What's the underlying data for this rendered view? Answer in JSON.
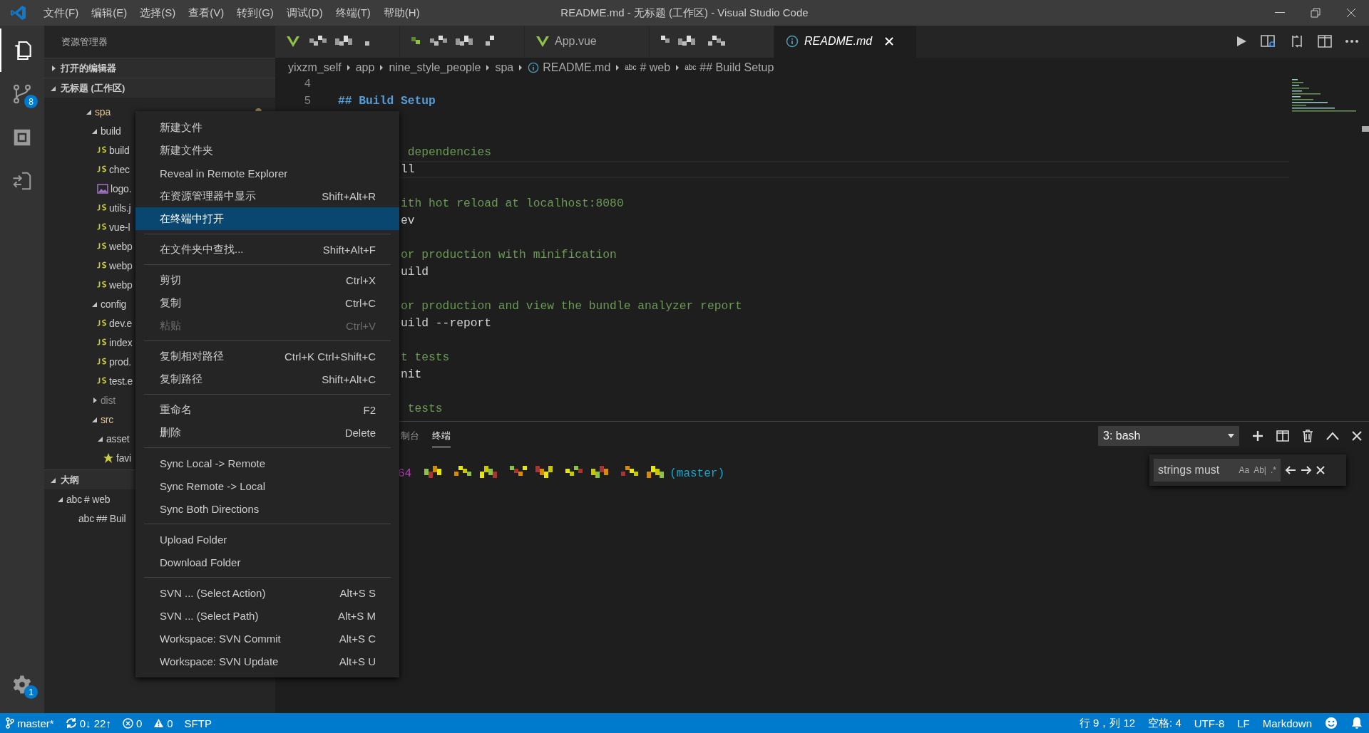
{
  "title_bar": {
    "menus": [
      "文件(F)",
      "编辑(E)",
      "选择(S)",
      "查看(V)",
      "转到(G)",
      "调试(D)",
      "终端(T)",
      "帮助(H)"
    ],
    "title": "README.md - 无标题 (工作区) - Visual Studio Code"
  },
  "activity_bar": {
    "items": [
      {
        "kind": "explorer",
        "selected": true
      },
      {
        "kind": "scm",
        "badge": "8",
        "selected": false
      },
      {
        "kind": "extensions",
        "selected": false
      },
      {
        "kind": "remote",
        "selected": false
      }
    ],
    "settings_badge": "1"
  },
  "sidebar": {
    "title": "资源管理器",
    "sections": [
      {
        "label": "打开的编辑器",
        "expanded": false
      },
      {
        "label": "无标题 (工作区)",
        "expanded": true
      }
    ],
    "tree": [
      {
        "label": "spa",
        "kind": "folder",
        "expanded": true,
        "modified": true,
        "children": [
          {
            "label": "build",
            "kind": "folder",
            "expanded": true,
            "children": [
              {
                "label": "build",
                "kind": "js"
              },
              {
                "label": "chec",
                "kind": "js"
              },
              {
                "label": "logo.",
                "kind": "image"
              },
              {
                "label": "utils.j",
                "kind": "js"
              },
              {
                "label": "vue-l",
                "kind": "js"
              },
              {
                "label": "webp",
                "kind": "js"
              },
              {
                "label": "webp",
                "kind": "js"
              },
              {
                "label": "webp",
                "kind": "js"
              }
            ]
          },
          {
            "label": "config",
            "kind": "folder",
            "expanded": true,
            "children": [
              {
                "label": "dev.e",
                "kind": "js"
              },
              {
                "label": "index",
                "kind": "js"
              },
              {
                "label": "prod.",
                "kind": "js"
              },
              {
                "label": "test.e",
                "kind": "js"
              }
            ]
          },
          {
            "label": "dist",
            "kind": "folder",
            "expanded": false,
            "ignored": true
          },
          {
            "label": "src",
            "kind": "folder",
            "expanded": true,
            "modified": true,
            "children": [
              {
                "label": "asset",
                "kind": "folder",
                "expanded": true,
                "children": [
                  {
                    "label": "favi",
                    "kind": "favicon"
                  }
                ]
              }
            ]
          }
        ]
      }
    ],
    "outline": {
      "label": "大纲",
      "expanded": true,
      "items": [
        {
          "symbol": "abc",
          "label": "# web",
          "expanded": true,
          "children": [
            {
              "symbol": "abc",
              "label": "## Buil"
            }
          ]
        }
      ]
    }
  },
  "tabs": [
    {
      "kind": "vue",
      "redacted": true,
      "selected": false
    },
    {
      "kind": "unknown",
      "redacted": true,
      "selected": false
    },
    {
      "kind": "vue",
      "label": "App.vue",
      "redacted": false,
      "preview": false,
      "selected": false
    },
    {
      "kind": "none",
      "redacted": true,
      "selected": false
    },
    {
      "kind": "md",
      "label": "README.md",
      "redacted": false,
      "preview": true,
      "selected": true
    }
  ],
  "breadcrumbs": [
    {
      "kind": "folder",
      "label": "yixzm_self"
    },
    {
      "kind": "folder",
      "label": "app"
    },
    {
      "kind": "folder",
      "label": "nine_style_people"
    },
    {
      "kind": "folder",
      "label": "spa"
    },
    {
      "kind": "file",
      "label": "README.md"
    },
    {
      "kind": "symbol",
      "symbol": "abc",
      "label": "# web"
    },
    {
      "kind": "symbol",
      "symbol": "abc",
      "label": "## Build Setup"
    }
  ],
  "editor": {
    "lines": [
      {
        "number": "4",
        "kind": "blank",
        "current": false
      },
      {
        "number": "5",
        "kind": "heading",
        "text": "## Build Setup",
        "current": false
      },
      {
        "kind": "blank",
        "current": false
      },
      {
        "kind": "blank",
        "current": false
      },
      {
        "kind": "comment",
        "text": " dependencies",
        "current": false
      },
      {
        "kind": "code",
        "text": "ll",
        "current": true
      },
      {
        "kind": "blank",
        "current": false
      },
      {
        "kind": "comment",
        "text": "ith hot reload at localhost:8080",
        "current": false
      },
      {
        "kind": "code",
        "text": "ev",
        "current": false
      },
      {
        "kind": "blank",
        "current": false
      },
      {
        "kind": "comment",
        "text": "or production with minification",
        "current": false
      },
      {
        "kind": "code",
        "text": "uild",
        "current": false
      },
      {
        "kind": "blank",
        "current": false
      },
      {
        "kind": "comment",
        "text": "or production and view the bundle analyzer report",
        "current": false
      },
      {
        "kind": "code",
        "text": "uild --report",
        "current": false
      },
      {
        "kind": "blank",
        "current": false
      },
      {
        "kind": "comment",
        "text": "t tests",
        "current": false
      },
      {
        "kind": "code",
        "text": "nit",
        "current": false
      },
      {
        "kind": "blank",
        "current": false
      },
      {
        "kind": "comment",
        "text": " tests",
        "current": false
      }
    ]
  },
  "context_menu": [
    [
      {
        "label": "新建文件",
        "selected": false,
        "disabled": false
      },
      {
        "label": "新建文件夹",
        "selected": false,
        "disabled": false
      },
      {
        "label": "Reveal in Remote Explorer",
        "selected": false,
        "disabled": false
      },
      {
        "label": "在资源管理器中显示",
        "shortcut": "Shift+Alt+R",
        "selected": false,
        "disabled": false
      },
      {
        "label": "在终端中打开",
        "selected": true,
        "disabled": false
      }
    ],
    [
      {
        "label": "在文件夹中查找...",
        "shortcut": "Shift+Alt+F",
        "selected": false,
        "disabled": false
      }
    ],
    [
      {
        "label": "剪切",
        "shortcut": "Ctrl+X",
        "selected": false,
        "disabled": false
      },
      {
        "label": "复制",
        "shortcut": "Ctrl+C",
        "selected": false,
        "disabled": false
      },
      {
        "label": "粘贴",
        "shortcut": "Ctrl+V",
        "selected": false,
        "disabled": true
      }
    ],
    [
      {
        "label": "复制相对路径",
        "shortcut": "Ctrl+K Ctrl+Shift+C",
        "selected": false,
        "disabled": false
      },
      {
        "label": "复制路径",
        "shortcut": "Shift+Alt+C",
        "selected": false,
        "disabled": false
      }
    ],
    [
      {
        "label": "重命名",
        "shortcut": "F2",
        "selected": false,
        "disabled": false
      },
      {
        "label": "删除",
        "shortcut": "Delete",
        "selected": false,
        "disabled": false
      }
    ],
    [
      {
        "label": "Sync Local -> Remote",
        "selected": false,
        "disabled": false
      },
      {
        "label": "Sync Remote -> Local",
        "selected": false,
        "disabled": false
      },
      {
        "label": "Sync Both Directions",
        "selected": false,
        "disabled": false
      }
    ],
    [
      {
        "label": "Upload Folder",
        "selected": false,
        "disabled": false
      },
      {
        "label": "Download Folder",
        "selected": false,
        "disabled": false
      }
    ],
    [
      {
        "label": "SVN ... (Select Action)",
        "shortcut": "Alt+S S",
        "selected": false,
        "disabled": false
      },
      {
        "label": "SVN ... (Select Path)",
        "shortcut": "Alt+S M",
        "selected": false,
        "disabled": false
      },
      {
        "label": "Workspace: SVN Commit",
        "shortcut": "Alt+S C",
        "selected": false,
        "disabled": false
      },
      {
        "label": "Workspace: SVN Update",
        "shortcut": "Alt+S U",
        "selected": false,
        "disabled": false
      }
    ]
  ],
  "panel": {
    "tabs": [
      {
        "label": "制台",
        "selected": false
      },
      {
        "label": "终端",
        "selected": true
      }
    ],
    "terminal_select": "3: bash",
    "find": {
      "value": "strings must",
      "options": [
        "Aa",
        "Ab|",
        ".*"
      ]
    },
    "terminal": {
      "prefix": "64",
      "redacted": true,
      "branch": "(master)"
    }
  },
  "status_bar": {
    "left": [
      {
        "kind": "branch",
        "label": "master*"
      },
      {
        "kind": "sync",
        "label": "0↓ 22↑"
      },
      {
        "kind": "errors",
        "label": "0"
      },
      {
        "kind": "warnings",
        "label": "0"
      },
      {
        "kind": "text",
        "label": "SFTP"
      }
    ],
    "right": [
      {
        "label": "行 9，列 12"
      },
      {
        "label": "空格: 4"
      },
      {
        "label": "UTF-8"
      },
      {
        "label": "LF"
      },
      {
        "label": "Markdown"
      }
    ]
  }
}
